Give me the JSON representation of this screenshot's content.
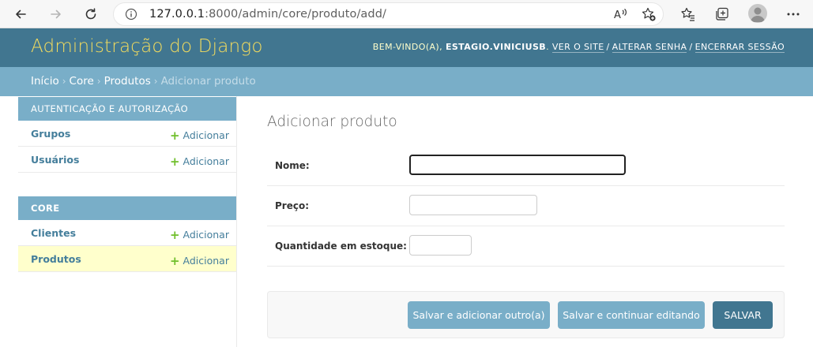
{
  "browser": {
    "url_host": "127.0.0.1",
    "url_path": ":8000/admin/core/produto/add/"
  },
  "header": {
    "branding": "Administração do Django",
    "welcome": "BEM-VINDO(A),",
    "username": "ESTAGIO.VINICIUSB",
    "view_site": "VER O SITE",
    "change_password": "ALTERAR SENHA",
    "logout": "ENCERRAR SESSÃO"
  },
  "breadcrumbs": {
    "home": "Início",
    "app": "Core",
    "model": "Produtos",
    "current": "Adicionar produto"
  },
  "sidebar": {
    "modules": [
      {
        "caption": "AUTENTICAÇÃO E AUTORIZAÇÃO",
        "items": [
          {
            "label": "Grupos",
            "add": "Adicionar"
          },
          {
            "label": "Usuários",
            "add": "Adicionar"
          }
        ]
      },
      {
        "caption": "CORE",
        "items": [
          {
            "label": "Clientes",
            "add": "Adicionar"
          },
          {
            "label": "Produtos",
            "add": "Adicionar"
          }
        ]
      }
    ]
  },
  "content": {
    "title": "Adicionar produto",
    "fields": [
      {
        "label": "Nome:",
        "value": ""
      },
      {
        "label": "Preço:",
        "value": ""
      },
      {
        "label": "Quantidade em estoque:",
        "value": ""
      }
    ]
  },
  "submit": {
    "save_add_another": "Salvar e adicionar outro(a)",
    "save_continue": "Salvar e continuar editando",
    "save": "SALVAR"
  },
  "colors": {
    "header_bg": "#417690",
    "breadcrumbs_bg": "#79aec8",
    "branding": "#f5dd5d",
    "link": "#447e9b",
    "add_icon": "#70bf2b",
    "current_row_bg": "#ffffcc"
  }
}
